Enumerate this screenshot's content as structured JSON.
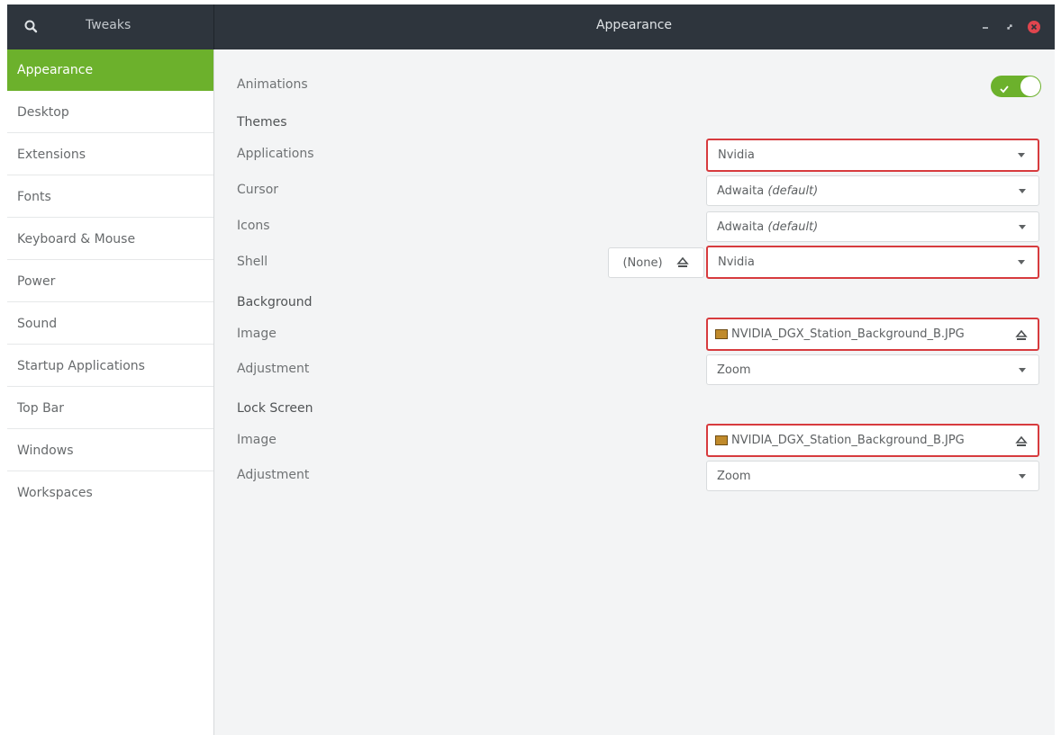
{
  "window": {
    "app_name": "Tweaks",
    "title": "Appearance"
  },
  "sidebar": {
    "items": [
      {
        "label": "Appearance",
        "active": true
      },
      {
        "label": "Desktop"
      },
      {
        "label": "Extensions"
      },
      {
        "label": "Fonts"
      },
      {
        "label": "Keyboard & Mouse"
      },
      {
        "label": "Power"
      },
      {
        "label": "Sound"
      },
      {
        "label": "Startup Applications"
      },
      {
        "label": "Top Bar"
      },
      {
        "label": "Windows"
      },
      {
        "label": "Workspaces"
      }
    ]
  },
  "content": {
    "animations": {
      "label": "Animations",
      "enabled": true
    },
    "themes": {
      "heading": "Themes",
      "applications": {
        "label": "Applications",
        "value": "Nvidia"
      },
      "cursor": {
        "label": "Cursor",
        "value": "Adwaita",
        "suffix": "(default)"
      },
      "icons": {
        "label": "Icons",
        "value": "Adwaita",
        "suffix": "(default)"
      },
      "shell": {
        "label": "Shell",
        "none_button": "(None)",
        "value": "Nvidia"
      }
    },
    "background": {
      "heading": "Background",
      "image": {
        "label": "Image",
        "file": "NVIDIA_DGX_Station_Background_B.JPG"
      },
      "adjustment": {
        "label": "Adjustment",
        "value": "Zoom"
      }
    },
    "lock_screen": {
      "heading": "Lock Screen",
      "image": {
        "label": "Image",
        "file": "NVIDIA_DGX_Station_Background_B.JPG"
      },
      "adjustment": {
        "label": "Adjustment",
        "value": "Zoom"
      }
    }
  },
  "colors": {
    "accent": "#6cb12c",
    "titlebar": "#2e353d",
    "highlight_border": "#d73b3e",
    "close_button": "#e0454e"
  },
  "icons": {
    "search": "search-icon",
    "minimize": "minimize-icon",
    "maximize": "maximize-icon",
    "close": "close-icon",
    "eject": "eject-icon",
    "image_file": "image-file-icon",
    "check": "check-icon"
  }
}
